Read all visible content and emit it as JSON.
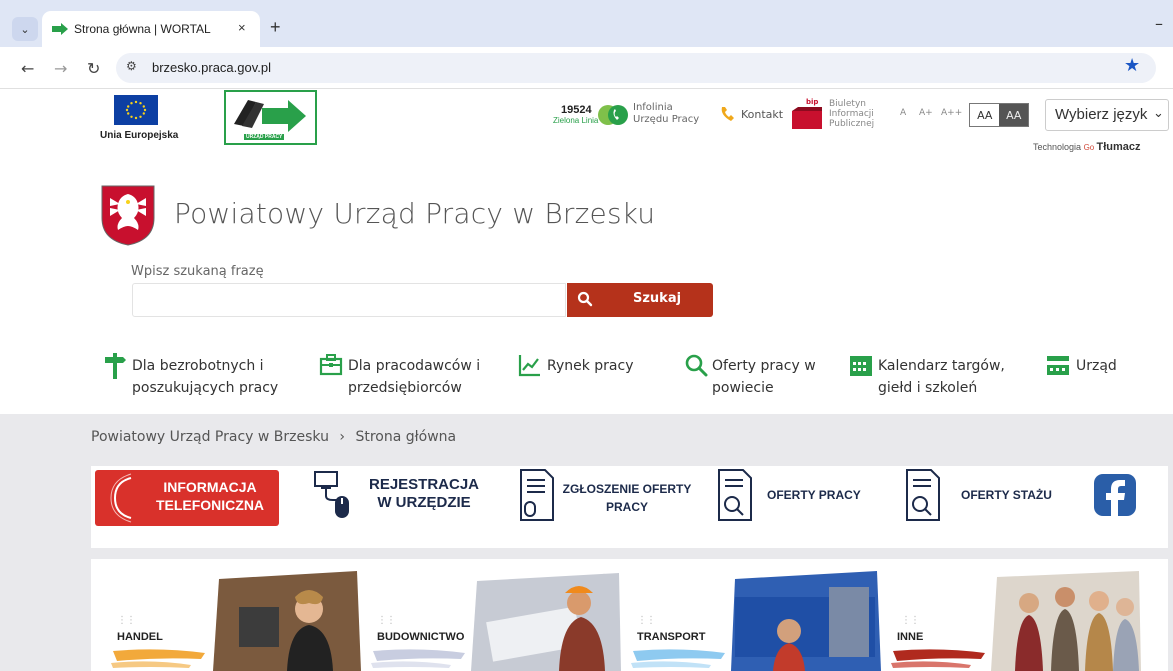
{
  "browser": {
    "tab_title": "Strona główna | WORTAL",
    "tab_close": "×",
    "new_tab": "+",
    "minimize": "–",
    "url": "brzesko.praca.gov.pl"
  },
  "header": {
    "eu_label": "Unia Europejska",
    "up_logo_label": "URZĄD PRACY",
    "infolinia_number": "19524",
    "infolinia_green": "Zielona Linia",
    "infolinia_text_1": "Infolinia",
    "infolinia_text_2": "Urzędu Pracy",
    "kontakt": "Kontakt",
    "bip_label": "bip",
    "bip_text_1": "Biuletyn",
    "bip_text_2": "Informacji",
    "bip_text_3": "Publicznej",
    "font_small": "A",
    "font_medium": "A+",
    "font_large": "A++",
    "contrast_normal": "AA",
    "contrast_high": "AA",
    "language_select": "Wybierz język",
    "tech_prefix": "Technologia",
    "tech_brand": "Tłumacz"
  },
  "site": {
    "title": "Powiatowy Urząd Pracy w Brzesku"
  },
  "search": {
    "label": "Wpisz szukaną frazę",
    "value": "",
    "button": "Szukaj"
  },
  "nav": [
    {
      "line1": "Dla bezrobotnych i",
      "line2": "poszukujących pracy"
    },
    {
      "line1": "Dla pracodawców i",
      "line2": "przedsiębiorców"
    },
    {
      "line1": "Rynek pracy",
      "line2": ""
    },
    {
      "line1": "Oferty pracy w",
      "line2": "powiecie"
    },
    {
      "line1": "Kalendarz targów,",
      "line2": "giełd i szkoleń"
    },
    {
      "line1": "Urząd",
      "line2": ""
    }
  ],
  "breadcrumb": {
    "home": "Powiatowy Urząd Pracy w Brzesku",
    "separator": "›",
    "current": "Strona główna"
  },
  "quicklinks": [
    {
      "line1": "INFORMACJA",
      "line2": "TELEFONICZNA"
    },
    {
      "line1": "REJESTRACJA",
      "line2": "W URZĘDZIE"
    },
    {
      "line1": "ZGŁOSZENIE OFERTY",
      "line2": "PRACY"
    },
    {
      "line1": "OFERTY PRACY",
      "line2": ""
    },
    {
      "line1": "OFERTY STAŻU",
      "line2": ""
    }
  ],
  "categories": [
    "HANDEL",
    "BUDOWNICTWO",
    "TRANSPORT",
    "INNE"
  ],
  "colors": {
    "accent_red": "#b5321b",
    "green": "#29a04a",
    "brand_navy": "#1c2a4a"
  }
}
